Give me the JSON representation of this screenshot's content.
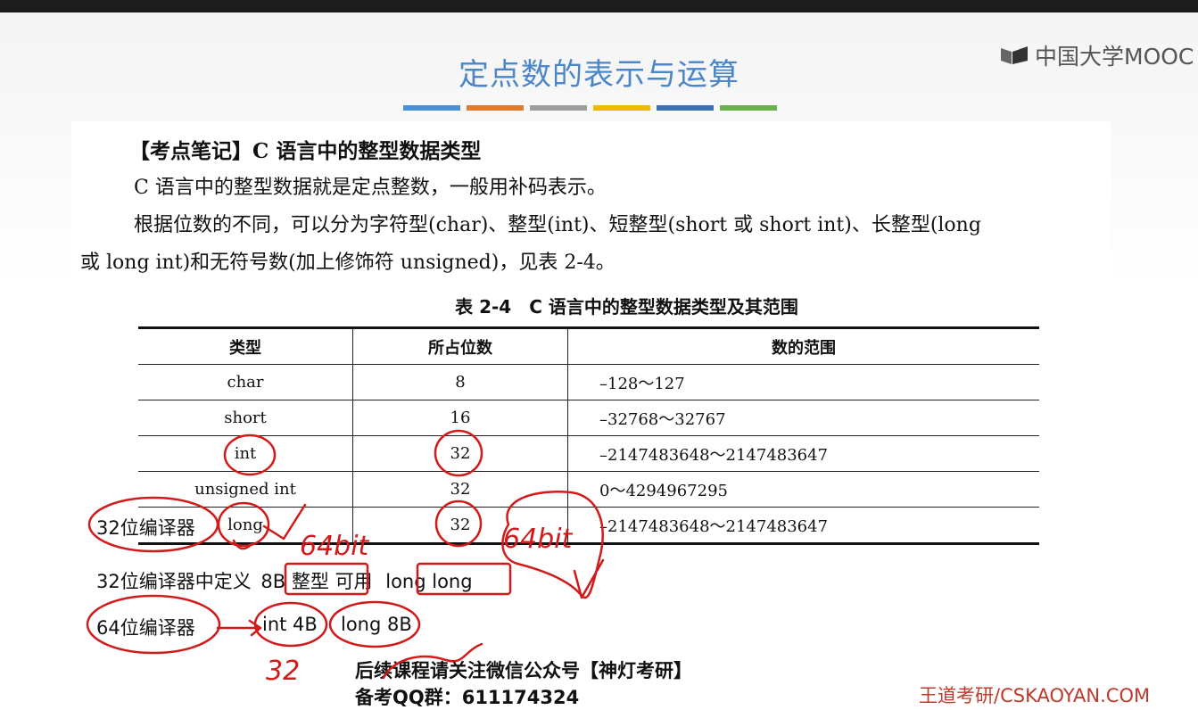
{
  "slide": {
    "title": "定点数的表示与运算",
    "accent_colors": [
      "#4a90d9",
      "#e07b2e",
      "#9e9e9e",
      "#f2b800",
      "#3d6fb6",
      "#6ab04c"
    ],
    "logo_text": "中国大学MOOC"
  },
  "doc": {
    "heading": "【考点笔记】C 语言中的整型数据类型",
    "para1": "C 语言中的整型数据就是定点整数，一般用补码表示。",
    "para2": "根据位数的不同，可以分为字符型(char)、整型(int)、短整型(short 或 short int)、长整型(long",
    "para3": "或 long int)和无符号数(加上修饰符 unsigned)，见表 2-4。"
  },
  "table": {
    "caption": "表 2-4　C 语言中的整型数据类型及其范围",
    "headers": [
      "类型",
      "所占位数",
      "数的范围"
    ],
    "rows": [
      [
        "char",
        "8",
        "–128～127"
      ],
      [
        "short",
        "16",
        "–32768～32767"
      ],
      [
        "int",
        "32",
        "–2147483648～2147483647"
      ],
      [
        "unsigned int",
        "32",
        "0～4294967295"
      ],
      [
        "long",
        "32",
        "–2147483648～2147483647"
      ]
    ]
  },
  "notes": {
    "compiler32_label": "32位编译器",
    "line1_prefix": "32位编译器中定义",
    "line1_box1": "8B 整型",
    "line1_mid": "可用",
    "line1_box2": "long long",
    "compiler64_label": "64位编译器",
    "line2_int": "int 4B",
    "line2_long": "long 8B"
  },
  "handwriting": {
    "long_note": "64bit",
    "bits_note": "64bit",
    "int_bits_note": "32"
  },
  "footer": {
    "line1": "后续课程请关注微信公众号【神灯考研】",
    "line2": "备考QQ群：611174324",
    "watermark": "王道考研/CSKAOYAN.COM"
  }
}
